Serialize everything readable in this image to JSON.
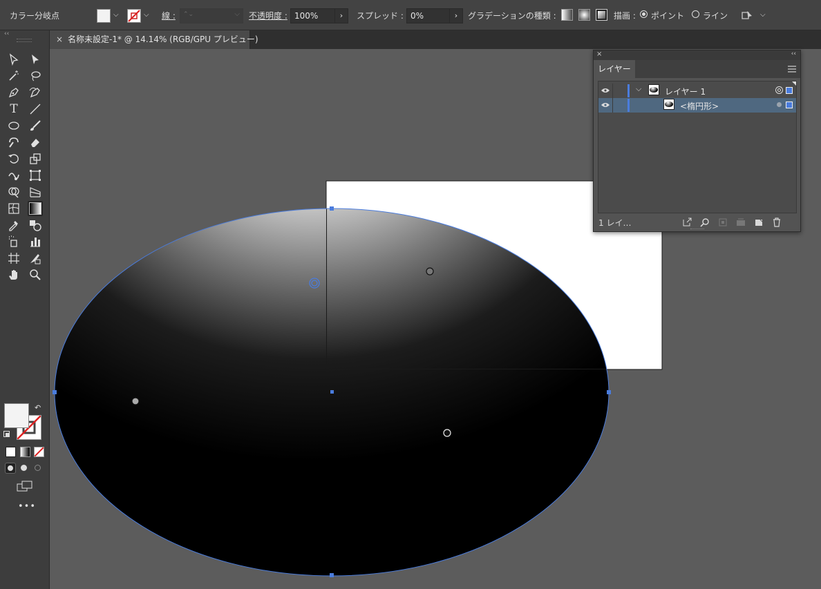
{
  "control_bar": {
    "mode_label": "カラー分岐点",
    "stroke_label": "線 :",
    "opacity_label": "不透明度 :",
    "opacity_value": "100%",
    "spread_label": "スプレッド :",
    "spread_value": "0%",
    "gradient_type_label": "グラデーションの種類 :",
    "draw_label": "描画 :",
    "point_option": "ポイント",
    "line_option": "ライン",
    "selected_draw_mode": "point"
  },
  "document": {
    "tab_title": "名称未設定-1* @ 14.14% (RGB/GPU プレビュー)",
    "close_glyph": "×"
  },
  "layers_panel": {
    "title": "レイヤー",
    "layers": [
      {
        "name": "レイヤー 1",
        "level": 0,
        "expanded": true,
        "selected": false
      },
      {
        "name": "<楕円形>",
        "level": 1,
        "selected": true
      }
    ],
    "footer_count": "1 レイ…"
  },
  "toolbar": {
    "more_glyph": "•••"
  },
  "colors": {
    "accent": "#4a7cdd",
    "layer_color": "#4a7cdd",
    "selection_row": "#4f6880",
    "ui_dark": "#3d3d3d"
  },
  "icons": [
    "selection-icon",
    "direct-selection-icon",
    "magic-wand-icon",
    "lasso-icon",
    "pen-icon",
    "curvature-icon",
    "type-icon",
    "line-icon",
    "ellipse-icon",
    "paintbrush-icon",
    "shaper-icon",
    "eraser-icon",
    "rotate-icon",
    "scale-icon",
    "warp-icon",
    "free-transform-icon",
    "shape-builder-icon",
    "perspective-icon",
    "mesh-icon",
    "gradient-icon",
    "eyedropper-icon",
    "blend-icon",
    "symbol-sprayer-icon",
    "column-graph-icon",
    "artboard-icon",
    "slice-icon",
    "hand-icon",
    "zoom-icon"
  ]
}
